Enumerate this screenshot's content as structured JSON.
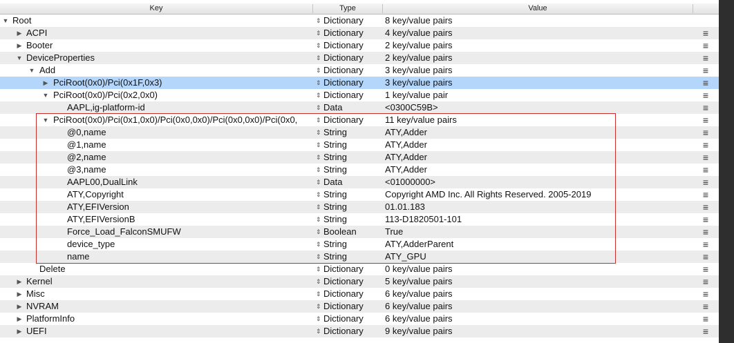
{
  "header": {
    "key": "Key",
    "type": "Type",
    "value": "Value"
  },
  "rows": [
    {
      "key": "Root",
      "type": "Dictionary",
      "value": "8 key/value pairs",
      "level": 0,
      "tri": "down",
      "menu": false
    },
    {
      "key": "ACPI",
      "type": "Dictionary",
      "value": "4 key/value pairs",
      "level": 1,
      "tri": "right",
      "menu": true
    },
    {
      "key": "Booter",
      "type": "Dictionary",
      "value": "2 key/value pairs",
      "level": 1,
      "tri": "right",
      "menu": true
    },
    {
      "key": "DeviceProperties",
      "type": "Dictionary",
      "value": "2 key/value pairs",
      "level": 1,
      "tri": "down",
      "menu": true
    },
    {
      "key": "Add",
      "type": "Dictionary",
      "value": "3 key/value pairs",
      "level": 2,
      "tri": "down",
      "menu": true
    },
    {
      "key": "PciRoot(0x0)/Pci(0x1F,0x3)",
      "type": "Dictionary",
      "value": "3 key/value pairs",
      "level": 3,
      "tri": "right",
      "menu": true,
      "selected": true
    },
    {
      "key": "PciRoot(0x0)/Pci(0x2,0x0)",
      "type": "Dictionary",
      "value": "1 key/value pair",
      "level": 3,
      "tri": "down",
      "menu": true
    },
    {
      "key": "AAPL,ig-platform-id",
      "type": "Data",
      "value": "<0300C59B>",
      "level": 4,
      "tri": "none",
      "menu": true
    },
    {
      "key": "PciRoot(0x0)/Pci(0x1,0x0)/Pci(0x0,0x0)/Pci(0x0,0x0)/Pci(0x0,",
      "type": "Dictionary",
      "value": "11 key/value pairs",
      "level": 3,
      "tri": "down",
      "menu": true
    },
    {
      "key": "@0,name",
      "type": "String",
      "value": "ATY,Adder",
      "level": 4,
      "tri": "none",
      "menu": true
    },
    {
      "key": "@1,name",
      "type": "String",
      "value": "ATY,Adder",
      "level": 4,
      "tri": "none",
      "menu": true
    },
    {
      "key": "@2,name",
      "type": "String",
      "value": "ATY,Adder",
      "level": 4,
      "tri": "none",
      "menu": true
    },
    {
      "key": "@3,name",
      "type": "String",
      "value": "ATY,Adder",
      "level": 4,
      "tri": "none",
      "menu": true
    },
    {
      "key": "AAPL00,DualLink",
      "type": "Data",
      "value": "<01000000>",
      "level": 4,
      "tri": "none",
      "menu": true
    },
    {
      "key": "ATY,Copyright",
      "type": "String",
      "value": "Copyright AMD Inc. All Rights Reserved. 2005-2019",
      "level": 4,
      "tri": "none",
      "menu": true
    },
    {
      "key": "ATY,EFIVersion",
      "type": "String",
      "value": "01.01.183",
      "level": 4,
      "tri": "none",
      "menu": true
    },
    {
      "key": "ATY,EFIVersionB",
      "type": "String",
      "value": "113-D1820501-101",
      "level": 4,
      "tri": "none",
      "menu": true
    },
    {
      "key": "Force_Load_FalconSMUFW",
      "type": "Boolean",
      "value": "True",
      "level": 4,
      "tri": "none",
      "menu": true
    },
    {
      "key": "device_type",
      "type": "String",
      "value": "ATY,AdderParent",
      "level": 4,
      "tri": "none",
      "menu": true
    },
    {
      "key": "name",
      "type": "String",
      "value": "ATY_GPU",
      "level": 4,
      "tri": "none",
      "menu": true
    },
    {
      "key": "Delete",
      "type": "Dictionary",
      "value": "0 key/value pairs",
      "level": 2,
      "tri": "none",
      "menu": true
    },
    {
      "key": "Kernel",
      "type": "Dictionary",
      "value": "5 key/value pairs",
      "level": 1,
      "tri": "right",
      "menu": true
    },
    {
      "key": "Misc",
      "type": "Dictionary",
      "value": "6 key/value pairs",
      "level": 1,
      "tri": "right",
      "menu": true
    },
    {
      "key": "NVRAM",
      "type": "Dictionary",
      "value": "6 key/value pairs",
      "level": 1,
      "tri": "right",
      "menu": true
    },
    {
      "key": "PlatformInfo",
      "type": "Dictionary",
      "value": "6 key/value pairs",
      "level": 1,
      "tri": "right",
      "menu": true
    },
    {
      "key": "UEFI",
      "type": "Dictionary",
      "value": "9 key/value pairs",
      "level": 1,
      "tri": "right",
      "menu": true
    }
  ],
  "icons": {
    "expanded": "▼",
    "collapsed": "▶",
    "type_stepper": "⇕",
    "row_menu": "≡"
  },
  "colors": {
    "selection": "#b4d6fb",
    "highlight_box": "#cc2b2b",
    "alt_row": "#ececec"
  }
}
